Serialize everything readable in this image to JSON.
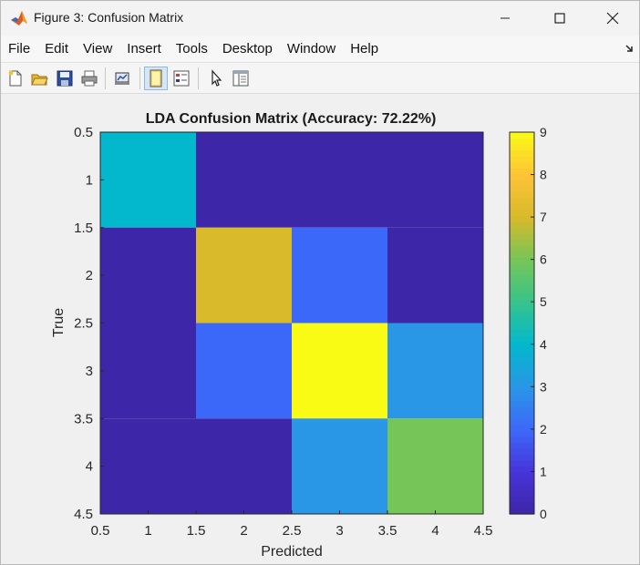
{
  "window": {
    "title": "Figure 3: Confusion Matrix",
    "icon": "matlab-logo-icon"
  },
  "menu": [
    "File",
    "Edit",
    "View",
    "Insert",
    "Tools",
    "Desktop",
    "Window",
    "Help"
  ],
  "toolbar": {
    "icons": [
      "new-figure-icon",
      "open-file-icon",
      "save-icon",
      "print-icon",
      "link-plot-icon",
      "hide-plot-tools-icon",
      "show-plot-tools-icon",
      "edit-plot-icon",
      "plot-browser-icon"
    ]
  },
  "colors": {
    "accent_active": "#d5e6f7",
    "parula_low": "#3e26a8",
    "parula_high": "#f9fb15"
  },
  "chart_data": {
    "type": "heatmap",
    "title": "LDA Confusion Matrix (Accuracy: 72.22%)",
    "xlabel": "Predicted",
    "ylabel": "True",
    "xlim": [
      0.5,
      4.5
    ],
    "ylim": [
      0.5,
      4.5
    ],
    "y_direction": "reverse",
    "x_ticks": [
      "0.5",
      "1",
      "1.5",
      "2",
      "2.5",
      "3",
      "3.5",
      "4",
      "4.5"
    ],
    "y_ticks": [
      "0.5",
      "1",
      "1.5",
      "2",
      "2.5",
      "3",
      "3.5",
      "4",
      "4.5"
    ],
    "matrix": [
      [
        4,
        0,
        0,
        0
      ],
      [
        0,
        7,
        2,
        0
      ],
      [
        0,
        2,
        9,
        3
      ],
      [
        0,
        0,
        3,
        6
      ]
    ],
    "colormap": "parula",
    "clim": [
      0,
      9
    ],
    "colorbar_ticks": [
      "0",
      "1",
      "2",
      "3",
      "4",
      "5",
      "6",
      "7",
      "8",
      "9"
    ],
    "grid": false
  }
}
